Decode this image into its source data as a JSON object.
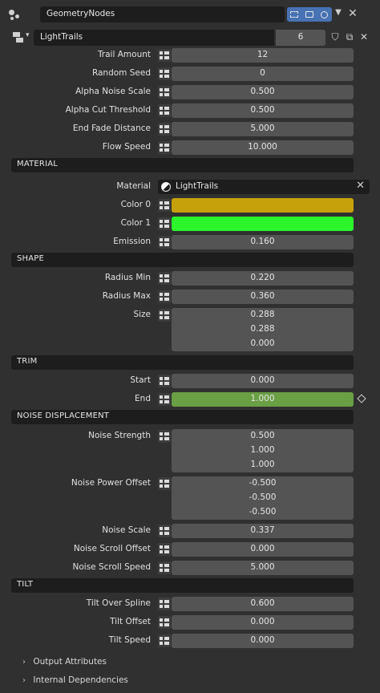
{
  "header": {
    "modifier_name": "GeometryNodes",
    "icon": "geometry-nodes-modifier-icon",
    "toggles": [
      "edit-mode-icon",
      "viewport-icon",
      "render-camera-icon"
    ],
    "accent": "#4772b3"
  },
  "node_group": {
    "name": "LightTrails",
    "users": "6"
  },
  "inputs": [
    {
      "label": "Trail Amount",
      "value": "12"
    },
    {
      "label": "Random Seed",
      "value": "0"
    },
    {
      "label": "Alpha Noise Scale",
      "value": "0.500"
    },
    {
      "label": "Alpha Cut Threshold",
      "value": "0.500"
    },
    {
      "label": "End Fade Distance",
      "value": "5.000"
    },
    {
      "label": "Flow Speed",
      "value": "10.000"
    }
  ],
  "sections": {
    "material": "MATERIAL",
    "shape": "SHAPE",
    "trim": "TRIM",
    "noise": "NOISE DISPLACEMENT",
    "tilt": "TILT"
  },
  "material": {
    "material_label": "Material",
    "material_value": "LightTrails",
    "color0_label": "Color 0",
    "color0": "#c7a10c",
    "color1_label": "Color 1",
    "color1": "#2cf52c",
    "emission_label": "Emission",
    "emission_value": "0.160"
  },
  "shape": {
    "radius_min_label": "Radius Min",
    "radius_min": "0.220",
    "radius_max_label": "Radius Max",
    "radius_max": "0.360",
    "size_label": "Size",
    "size": [
      "0.288",
      "0.288",
      "0.000"
    ]
  },
  "trim": {
    "start_label": "Start",
    "start": "0.000",
    "end_label": "End",
    "end": "1.000",
    "end_fill_color": "#6a9f44"
  },
  "noise": {
    "strength_label": "Noise Strength",
    "strength": [
      "0.500",
      "1.000",
      "1.000"
    ],
    "power_label": "Noise Power Offset",
    "power": [
      "-0.500",
      "-0.500",
      "-0.500"
    ],
    "scale_label": "Noise Scale",
    "scale": "0.337",
    "scroll_offset_label": "Noise Scroll Offset",
    "scroll_offset": "0.000",
    "scroll_speed_label": "Noise Scroll Speed",
    "scroll_speed": "5.000"
  },
  "tilt": {
    "over_spline_label": "Tilt Over Spline",
    "over_spline": "0.600",
    "offset_label": "Tilt Offset",
    "offset": "0.000",
    "speed_label": "Tilt Speed",
    "speed": "0.000"
  },
  "footer": {
    "output_attributes": "Output Attributes",
    "internal_dependencies": "Internal Dependencies"
  }
}
